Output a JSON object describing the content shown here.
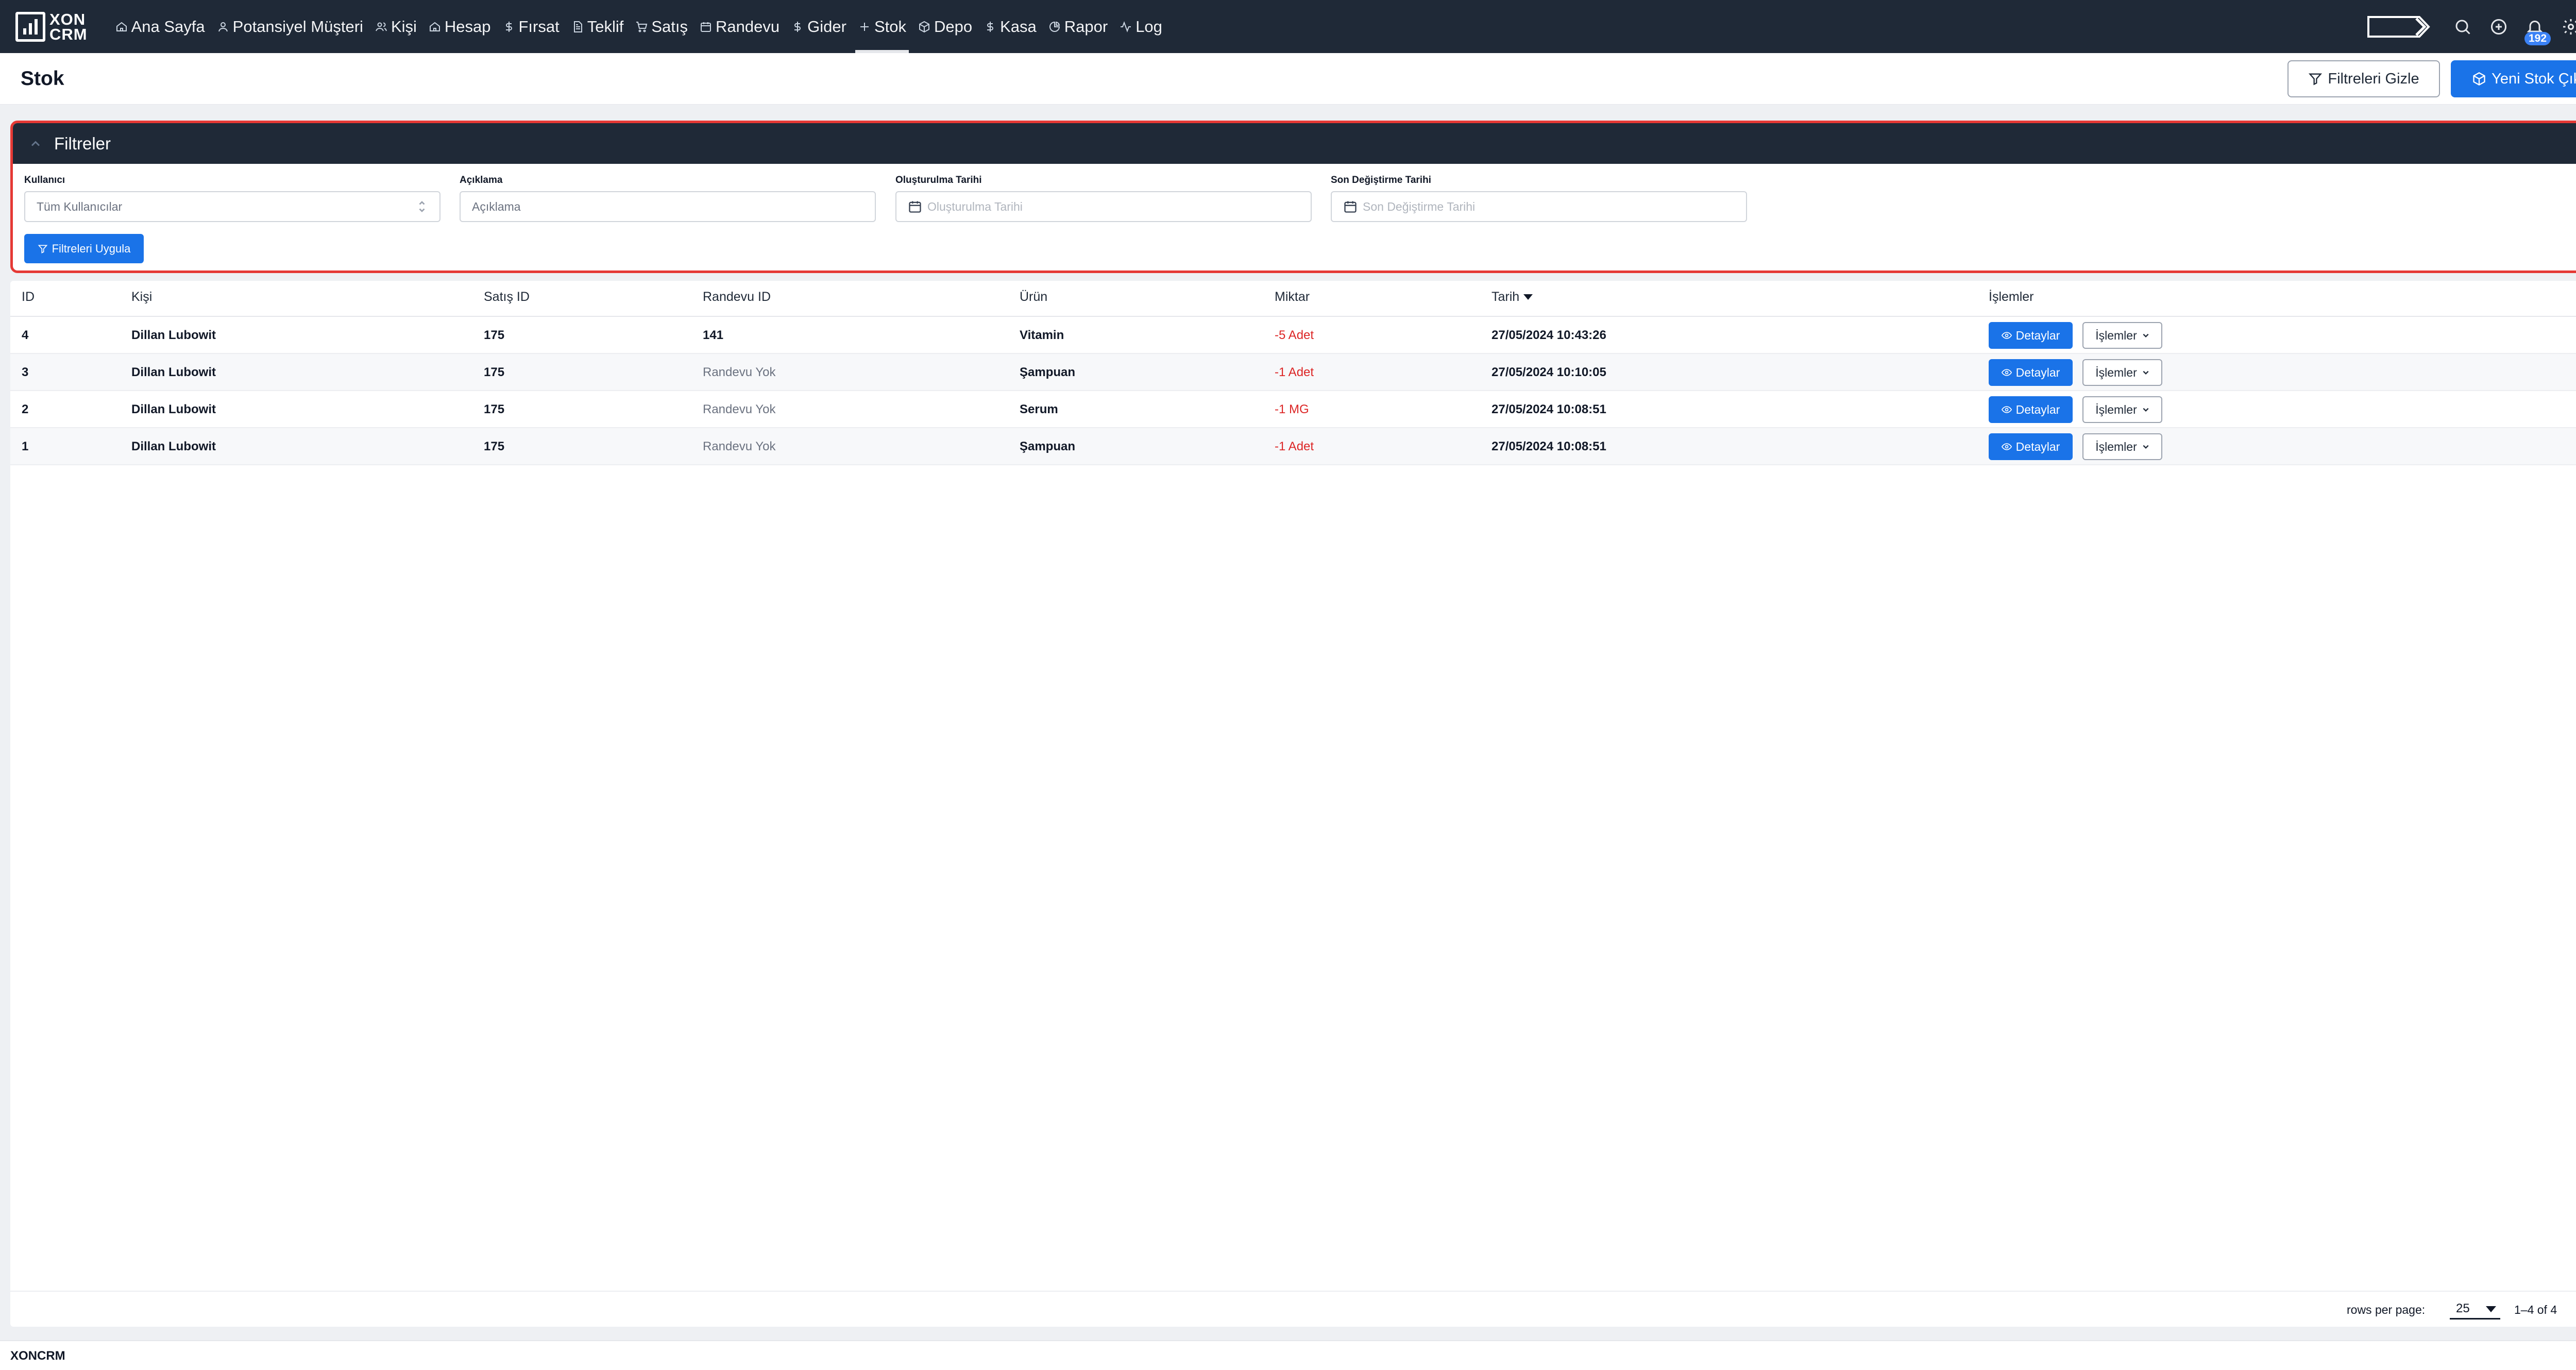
{
  "app": {
    "logo_line1": "XON",
    "logo_line2": "CRM",
    "footer": "XONCRM"
  },
  "nav": {
    "items": [
      {
        "label": "Ana Sayfa",
        "icon": "home-icon"
      },
      {
        "label": "Potansiyel Müşteri",
        "icon": "user-icon"
      },
      {
        "label": "Kişi",
        "icon": "users-icon"
      },
      {
        "label": "Hesap",
        "icon": "home-icon"
      },
      {
        "label": "Fırsat",
        "icon": "dollar-icon"
      },
      {
        "label": "Teklif",
        "icon": "document-icon"
      },
      {
        "label": "Satış",
        "icon": "cart-icon"
      },
      {
        "label": "Randevu",
        "icon": "calendar-icon"
      },
      {
        "label": "Gider",
        "icon": "dollar-icon"
      },
      {
        "label": "Stok",
        "icon": "plus-icon",
        "active": true
      },
      {
        "label": "Depo",
        "icon": "box-icon"
      },
      {
        "label": "Kasa",
        "icon": "dollar-icon"
      },
      {
        "label": "Rapor",
        "icon": "pie-chart-icon"
      },
      {
        "label": "Log",
        "icon": "activity-icon"
      }
    ],
    "notification_count": "192"
  },
  "page": {
    "title": "Stok",
    "hide_filters_label": "Filtreleri Gizle",
    "new_stock_out_label": "Yeni Stok Çıkışı"
  },
  "filters": {
    "title": "Filtreler",
    "user": {
      "label": "Kullanıcı",
      "value": "Tüm Kullanıcılar"
    },
    "description": {
      "label": "Açıklama",
      "placeholder": "Açıklama"
    },
    "created_date": {
      "label": "Oluşturulma Tarihi",
      "placeholder": "Oluşturulma Tarihi"
    },
    "modified_date": {
      "label": "Son Değiştirme Tarihi",
      "placeholder": "Son Değiştirme Tarihi"
    },
    "apply_label": "Filtreleri Uygula"
  },
  "table": {
    "columns": {
      "id": "ID",
      "person": "Kişi",
      "sale_id": "Satış ID",
      "appointment_id": "Randevu ID",
      "product": "Ürün",
      "quantity": "Miktar",
      "date": "Tarih",
      "actions": "İşlemler"
    },
    "details_label": "Detaylar",
    "actions_label": "İşlemler",
    "rows": [
      {
        "id": "4",
        "person": "Dillan Lubowit",
        "sale_id": "175",
        "appointment_id": "141",
        "product": "Vitamin",
        "quantity": "-5 Adet",
        "date": "27/05/2024 10:43:26"
      },
      {
        "id": "3",
        "person": "Dillan Lubowit",
        "sale_id": "175",
        "appointment_id": "Randevu Yok",
        "product": "Şampuan",
        "quantity": "-1 Adet",
        "date": "27/05/2024 10:10:05"
      },
      {
        "id": "2",
        "person": "Dillan Lubowit",
        "sale_id": "175",
        "appointment_id": "Randevu Yok",
        "product": "Serum",
        "quantity": "-1 MG",
        "date": "27/05/2024 10:08:51"
      },
      {
        "id": "1",
        "person": "Dillan Lubowit",
        "sale_id": "175",
        "appointment_id": "Randevu Yok",
        "product": "Şampuan",
        "quantity": "-1 Adet",
        "date": "27/05/2024 10:08:51"
      }
    ]
  },
  "pagination": {
    "rows_per_page_label": "rows per page:",
    "rows_per_page": "25",
    "range": "1–4 of 4"
  },
  "colors": {
    "nav_bg": "#1f2937",
    "primary": "#1a73e8",
    "filter_border": "#e53935",
    "negative": "#dc2626"
  }
}
